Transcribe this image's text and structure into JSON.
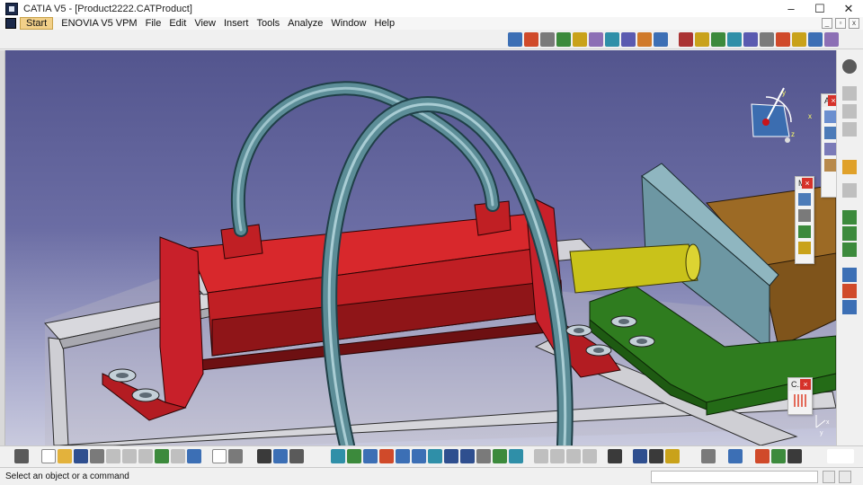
{
  "window": {
    "title": "CATIA V5 - [Product2222.CATProduct]",
    "minimize_label": "–",
    "maximize_label": "☐",
    "close_label": "✕"
  },
  "menubar": {
    "items": [
      "Start",
      "ENOVIA V5 VPM",
      "File",
      "Edit",
      "View",
      "Insert",
      "Tools",
      "Analyze",
      "Window",
      "Help"
    ]
  },
  "floating_toolbars": {
    "a_title": "A",
    "m_title": "M",
    "c_title": "C.."
  },
  "compass": {
    "x_label": "x",
    "y_label": "y",
    "z_label": "z"
  },
  "axis_triad": {
    "x_label": "x",
    "y_label": "y"
  },
  "statusbar": {
    "message": "Select an object or a command",
    "command_value": ""
  },
  "colors": {
    "background_top": "#53558e",
    "background_bottom": "#c9cade",
    "cylinder_red": "#c01f24",
    "hose_teal": "#5c8d97",
    "rod_yellow": "#c9c21a",
    "plate_blue": "#6d97a3",
    "base_green": "#2f7c1f",
    "block_brown": "#9c6a25"
  }
}
